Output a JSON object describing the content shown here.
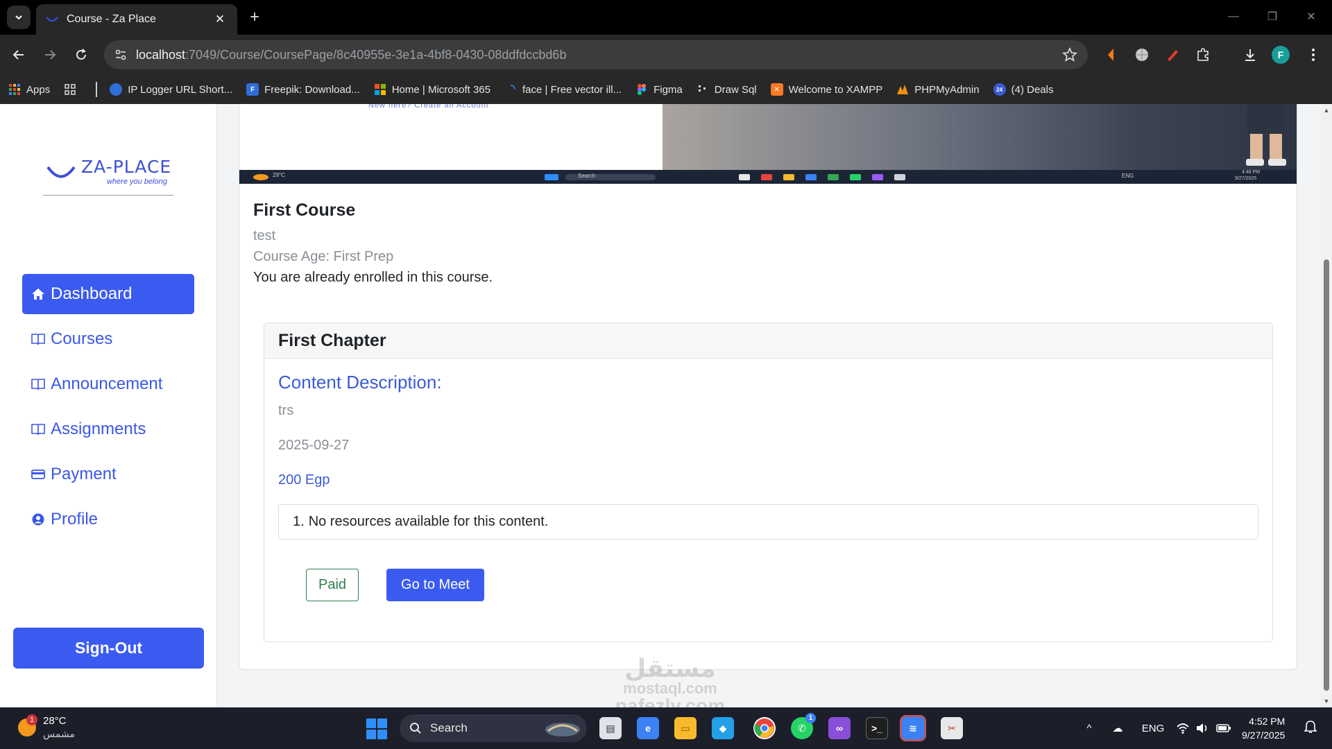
{
  "browser": {
    "tab_title": "Course - Za Place",
    "tab_close": "✕",
    "new_tab": "+",
    "url_host": "localhost",
    "url_path": ":7049/Course/CoursePage/8c40955e-3e1a-4bf8-0430-08ddfdccbd6b",
    "profile_initial": "F",
    "bookmarks": [
      {
        "label": "Apps",
        "icon": "apps-grid-icon",
        "color": "#e8453c"
      },
      {
        "label": "IP Logger URL Short...",
        "icon": "ip-logger-icon",
        "color": "#2f6fd8"
      },
      {
        "label": "Freepik: Download...",
        "icon": "freepik-icon",
        "color": "#2f6fd8"
      },
      {
        "label": "Home | Microsoft 365",
        "icon": "microsoft-icon",
        "color": "#f25022"
      },
      {
        "label": "face | Free vector ill...",
        "icon": "loading-icon",
        "color": "#2f6fd8"
      },
      {
        "label": "Figma",
        "icon": "figma-icon",
        "color": "#f24e1e"
      },
      {
        "label": "Draw Sql",
        "icon": "drawsql-icon",
        "color": "#444444"
      },
      {
        "label": "Welcome to XAMPP",
        "icon": "xampp-icon",
        "color": "#fb7a24"
      },
      {
        "label": "PHPMyAdmin",
        "icon": "phpmyadmin-icon",
        "color": "#f29111"
      },
      {
        "label": "(4) Deals",
        "icon": "deals-icon",
        "color": "#3b5bd6"
      }
    ]
  },
  "sidebar": {
    "logo_text": "ZA-PLACE",
    "logo_tagline": "where you belong",
    "items": [
      {
        "label": "Dashboard",
        "icon": "home-icon",
        "active": true
      },
      {
        "label": "Courses",
        "icon": "book-icon",
        "active": false
      },
      {
        "label": "Announcement",
        "icon": "book-icon",
        "active": false
      },
      {
        "label": "Assignments",
        "icon": "book-icon",
        "active": false
      },
      {
        "label": "Payment",
        "icon": "credit-card-icon",
        "active": false
      },
      {
        "label": "Profile",
        "icon": "user-circle-icon",
        "active": false
      }
    ],
    "signout_label": "Sign-Out"
  },
  "banner": {
    "link_text": "New here? Create an Account",
    "mini_taskbar_search": "Search",
    "mini_taskbar_lang": "ENG",
    "mini_taskbar_time": "4:46 PM",
    "mini_taskbar_date": "9/27/2025",
    "mini_taskbar_temp": "29°C"
  },
  "course": {
    "title": "First Course",
    "description": "test",
    "age": "Course Age: First Prep",
    "enrolled_message": "You are already enrolled in this course."
  },
  "chapter": {
    "title": "First Chapter",
    "content_heading": "Content Description:",
    "content_description": "trs",
    "date": "2025-09-27",
    "price": "200 Egp",
    "resources_number": "1.",
    "resources_message": "No resources available for this content.",
    "paid_label": "Paid",
    "meet_label": "Go to Meet"
  },
  "watermark": {
    "line1": "مستقل",
    "line2": "mostaql.com",
    "line3": "nafezly.com"
  },
  "taskbar": {
    "weather_temp": "28°C",
    "weather_condition": "مشمس",
    "weather_badge": "1",
    "search_placeholder": "Search",
    "lang": "ENG",
    "time": "4:52 PM",
    "date": "9/27/2025",
    "whatsapp_badge": "1"
  },
  "colors": {
    "accent": "#3b5bf0",
    "link_blue": "#3b5bd6",
    "paid_green": "#2f7d4f",
    "muted_text": "#8a8f95"
  }
}
